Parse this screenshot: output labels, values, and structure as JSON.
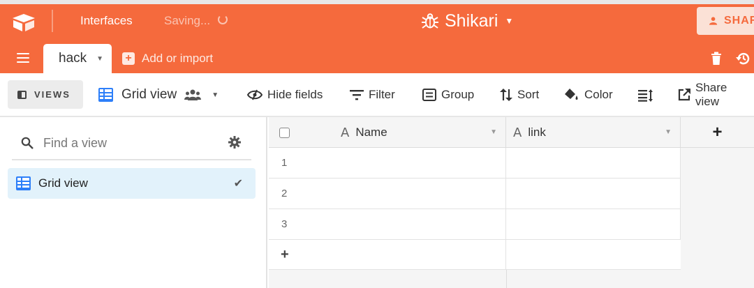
{
  "app": {
    "interfaces_label": "Interfaces",
    "saving_label": "Saving...",
    "base_name": "Shikari",
    "share_label": "SHARE",
    "brand_color": "#f56a3d"
  },
  "tables": {
    "active_tab": "hack",
    "add_import_label": "Add or import"
  },
  "toolbar": {
    "views_label": "VIEWS",
    "view_name": "Grid view",
    "hide_fields": "Hide fields",
    "filter": "Filter",
    "group": "Group",
    "sort": "Sort",
    "color": "Color",
    "share_view": "Share view"
  },
  "sidebar": {
    "search_placeholder": "Find a view",
    "views": [
      {
        "label": "Grid view",
        "selected": true
      }
    ]
  },
  "grid": {
    "columns": [
      {
        "label": "Name",
        "type": "text"
      },
      {
        "label": "link",
        "type": "text"
      }
    ],
    "rows": [
      {
        "num": "1",
        "name": "",
        "link": ""
      },
      {
        "num": "2",
        "name": "",
        "link": ""
      },
      {
        "num": "3",
        "name": "",
        "link": ""
      }
    ],
    "add_row_label": "+",
    "add_field_label": "+"
  }
}
